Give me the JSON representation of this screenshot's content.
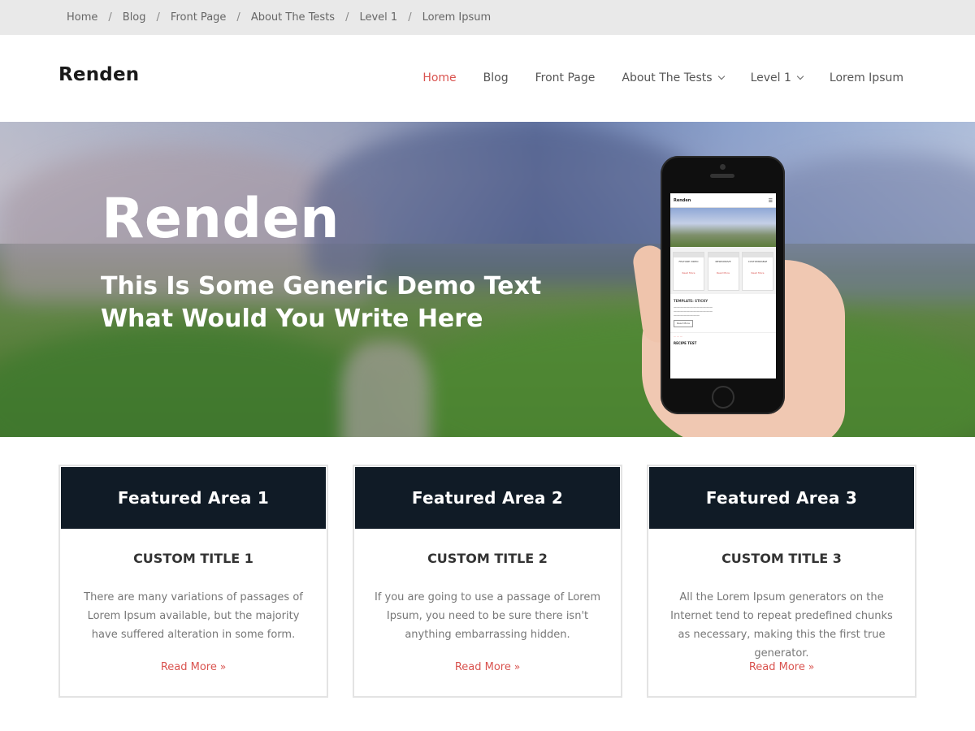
{
  "breadcrumb": {
    "items": [
      "Home",
      "Blog",
      "Front Page",
      "About The Tests",
      "Level 1",
      "Lorem Ipsum"
    ],
    "separator": "/"
  },
  "header": {
    "logo": "Renden",
    "nav": [
      {
        "label": "Home",
        "active": true
      },
      {
        "label": "Blog"
      },
      {
        "label": "Front Page"
      },
      {
        "label": "About The Tests",
        "dropdown": true
      },
      {
        "label": "Level 1",
        "dropdown": true
      },
      {
        "label": "Lorem Ipsum"
      }
    ],
    "accent_color": "#d9534f"
  },
  "hero": {
    "title": "Renden",
    "subtitle_line1": "This Is Some Generic Demo Text",
    "subtitle_line2": "What Would You Write Here",
    "phone": {
      "site_name": "Renden",
      "menu_icon": "hamburger-icon",
      "card_titles": [
        "FEATURE VIDEO",
        "RESPONSIVE",
        "CUSTOMIZABLE"
      ],
      "card_link": "Read More",
      "section_title": "TEMPLATE: STICKY",
      "button": "Read More",
      "footer_label": "RECIPE TEST"
    }
  },
  "featured": [
    {
      "heading": "Featured Area 1",
      "title": "CUSTOM TITLE 1",
      "text": "There are many variations of passages of Lorem Ipsum available, but the majority have suffered alteration in some form.",
      "link": "Read More"
    },
    {
      "heading": "Featured Area 2",
      "title": "CUSTOM TITLE 2",
      "text": "If you are going to use a passage of Lorem Ipsum, you need to be sure there isn't anything embarrassing hidden.",
      "link": "Read More"
    },
    {
      "heading": "Featured Area 3",
      "title": "CUSTOM TITLE 3",
      "text": "All the Lorem Ipsum generators on the Internet tend to repeat predefined chunks as necessary, making this the first true generator.",
      "link": "Read More"
    }
  ],
  "colors": {
    "card_header_bg": "#101b26",
    "topbar_bg": "#e9e9e9",
    "link": "#d9534f"
  }
}
